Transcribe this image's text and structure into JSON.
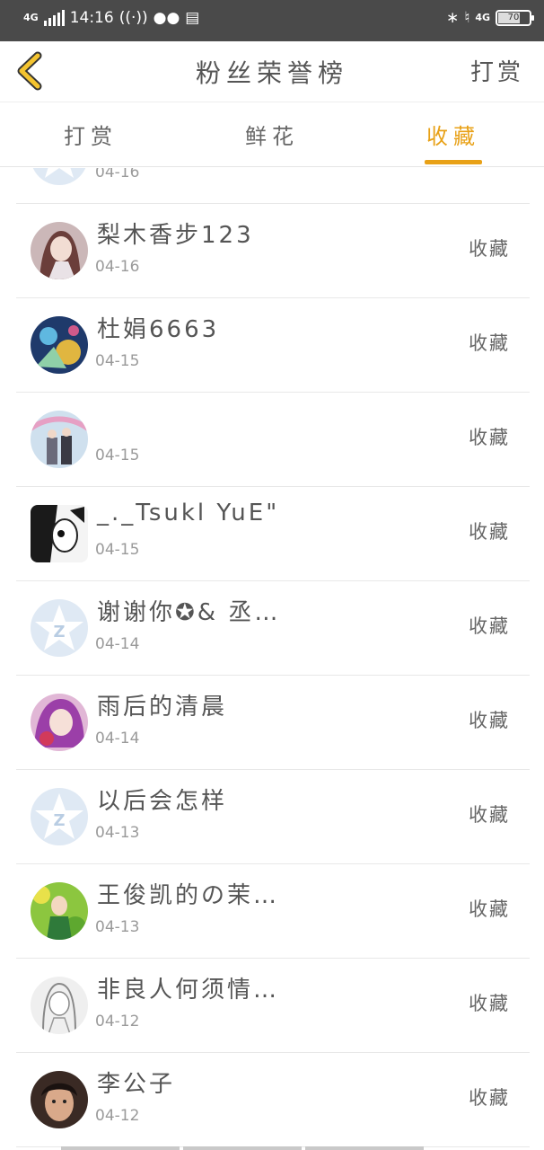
{
  "status_bar": {
    "network_left": "4G",
    "time": "14:16",
    "network_right": "4G",
    "battery": "70"
  },
  "header": {
    "title": "粉丝荣誉榜",
    "action": "打赏"
  },
  "tabs": [
    {
      "label": "打赏",
      "active": false
    },
    {
      "label": "鲜花",
      "active": false
    },
    {
      "label": "收藏",
      "active": true
    }
  ],
  "list": {
    "partial_date": "04-16",
    "items": [
      {
        "name": "梨木香步123",
        "date": "04-16",
        "action": "收藏",
        "avatar": "avatar-anime-girl"
      },
      {
        "name": "杜娟6663",
        "date": "04-15",
        "action": "收藏",
        "avatar": "avatar-fantasy"
      },
      {
        "name": "",
        "date": "04-15",
        "action": "收藏",
        "avatar": "avatar-couple"
      },
      {
        "name": "_._Tsukl YuE\"",
        "date": "04-15",
        "action": "收藏",
        "avatar": "avatar-sketch"
      },
      {
        "name": "谢谢你✪& 丞…",
        "date": "04-14",
        "action": "收藏",
        "avatar": "avatar-default"
      },
      {
        "name": "雨后的清晨",
        "date": "04-14",
        "action": "收藏",
        "avatar": "avatar-purple-hair"
      },
      {
        "name": "以后会怎样",
        "date": "04-13",
        "action": "收藏",
        "avatar": "avatar-default"
      },
      {
        "name": "王俊凯的の茉…",
        "date": "04-13",
        "action": "收藏",
        "avatar": "avatar-green"
      },
      {
        "name": "非良人何须情…",
        "date": "04-12",
        "action": "收藏",
        "avatar": "avatar-pencil"
      },
      {
        "name": "李公子",
        "date": "04-12",
        "action": "收藏",
        "avatar": "avatar-boy"
      }
    ]
  },
  "colors": {
    "accent": "#e8a117",
    "status_bar": "#4a4a4a",
    "text": "#555555",
    "muted": "#9a9a9a",
    "default_avatar": "#dfe9f4"
  }
}
